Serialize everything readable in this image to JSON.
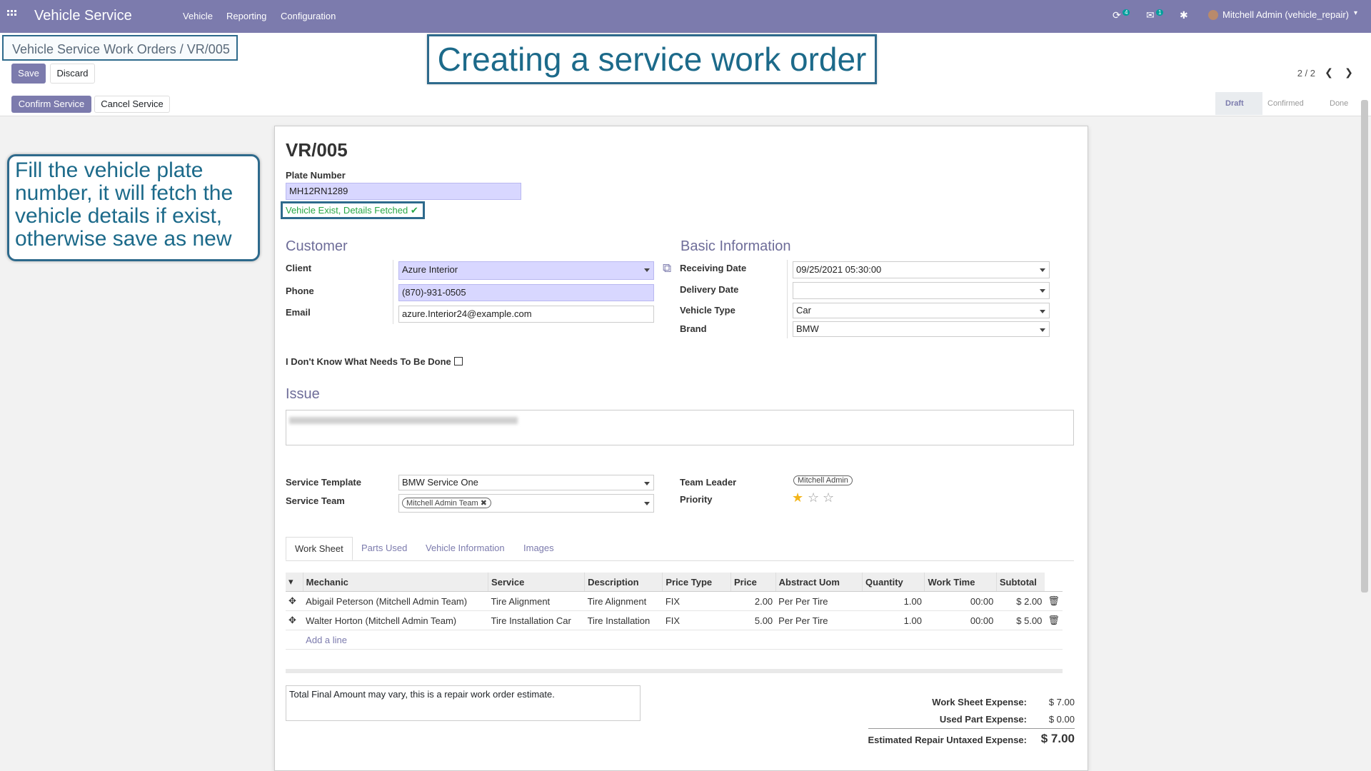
{
  "navbar": {
    "app_title": "Vehicle Service",
    "menu": [
      "Vehicle",
      "Reporting",
      "Configuration"
    ],
    "activity_count": "4",
    "message_count": "1",
    "user": "Mitchell Admin (vehicle_repair)"
  },
  "control": {
    "breadcrumb_parent": "Vehicle Service Work Orders",
    "breadcrumb_sep": "/",
    "breadcrumb_current": "VR/005",
    "save_label": "Save",
    "discard_label": "Discard",
    "pager": "2 / 2"
  },
  "callouts": {
    "title": "Creating a service work order",
    "left": "Fill the vehicle plate number, it will fetch the vehicle details  if exist, otherwise save as new"
  },
  "status": {
    "confirm_label": "Confirm Service",
    "cancel_label": "Cancel Service",
    "stages": [
      "Draft",
      "Confirmed",
      "Done"
    ],
    "active_stage": "Draft"
  },
  "form": {
    "title": "VR/005",
    "plate_label": "Plate Number",
    "plate_value": "MH12RN1289",
    "plate_message": "Vehicle Exist, Details Fetched ✔",
    "customer_section": "Customer",
    "basic_section": "Basic Information",
    "client_label": "Client",
    "client_value": "Azure Interior",
    "phone_label": "Phone",
    "phone_value": "(870)-931-0505",
    "email_label": "Email",
    "email_value": "azure.Interior24@example.com",
    "receiving_label": "Receiving Date",
    "receiving_value": "09/25/2021 05:30:00",
    "delivery_label": "Delivery Date",
    "delivery_value": "",
    "vehicle_type_label": "Vehicle Type",
    "vehicle_type_value": "Car",
    "brand_label": "Brand",
    "brand_value": "BMW",
    "dont_know_label": "I Don't Know What Needs To Be Done",
    "issue_section": "Issue",
    "template_label": "Service Template",
    "template_value": "BMW Service One",
    "team_label": "Service Team",
    "team_value": "Mitchell Admin Team",
    "leader_label": "Team Leader",
    "leader_value": "Mitchell Admin",
    "priority_label": "Priority",
    "priority_stars": 1
  },
  "tabs": [
    "Work Sheet",
    "Parts Used",
    "Vehicle Information",
    "Images"
  ],
  "worksheet": {
    "headers": [
      "Mechanic",
      "Service",
      "Description",
      "Price Type",
      "Price",
      "Abstract Uom",
      "Quantity",
      "Work Time",
      "Subtotal"
    ],
    "rows": [
      [
        "Abigail Peterson (Mitchell Admin Team)",
        "Tire Alignment",
        "Tire Alignment",
        "FIX",
        "2.00",
        "Per Per Tire",
        "1.00",
        "00:00",
        "$ 2.00"
      ],
      [
        "Walter Horton (Mitchell Admin Team)",
        "Tire Installation Car",
        "Tire Installation",
        "FIX",
        "5.00",
        "Per Per Tire",
        "1.00",
        "00:00",
        "$ 5.00"
      ]
    ],
    "add_line": "Add a line"
  },
  "footer": {
    "note": "Total Final Amount may vary, this is a repair work order estimate.",
    "worksheet_expense_label": "Work Sheet Expense:",
    "worksheet_expense": "$ 7.00",
    "part_expense_label": "Used Part Expense:",
    "part_expense": "$ 0.00",
    "estimated_label": "Estimated Repair Untaxed Expense:",
    "estimated": "$ 7.00"
  },
  "colors": {
    "navbar": "#7c7bad",
    "callout": "#1c6a8a",
    "success": "#28a745"
  }
}
